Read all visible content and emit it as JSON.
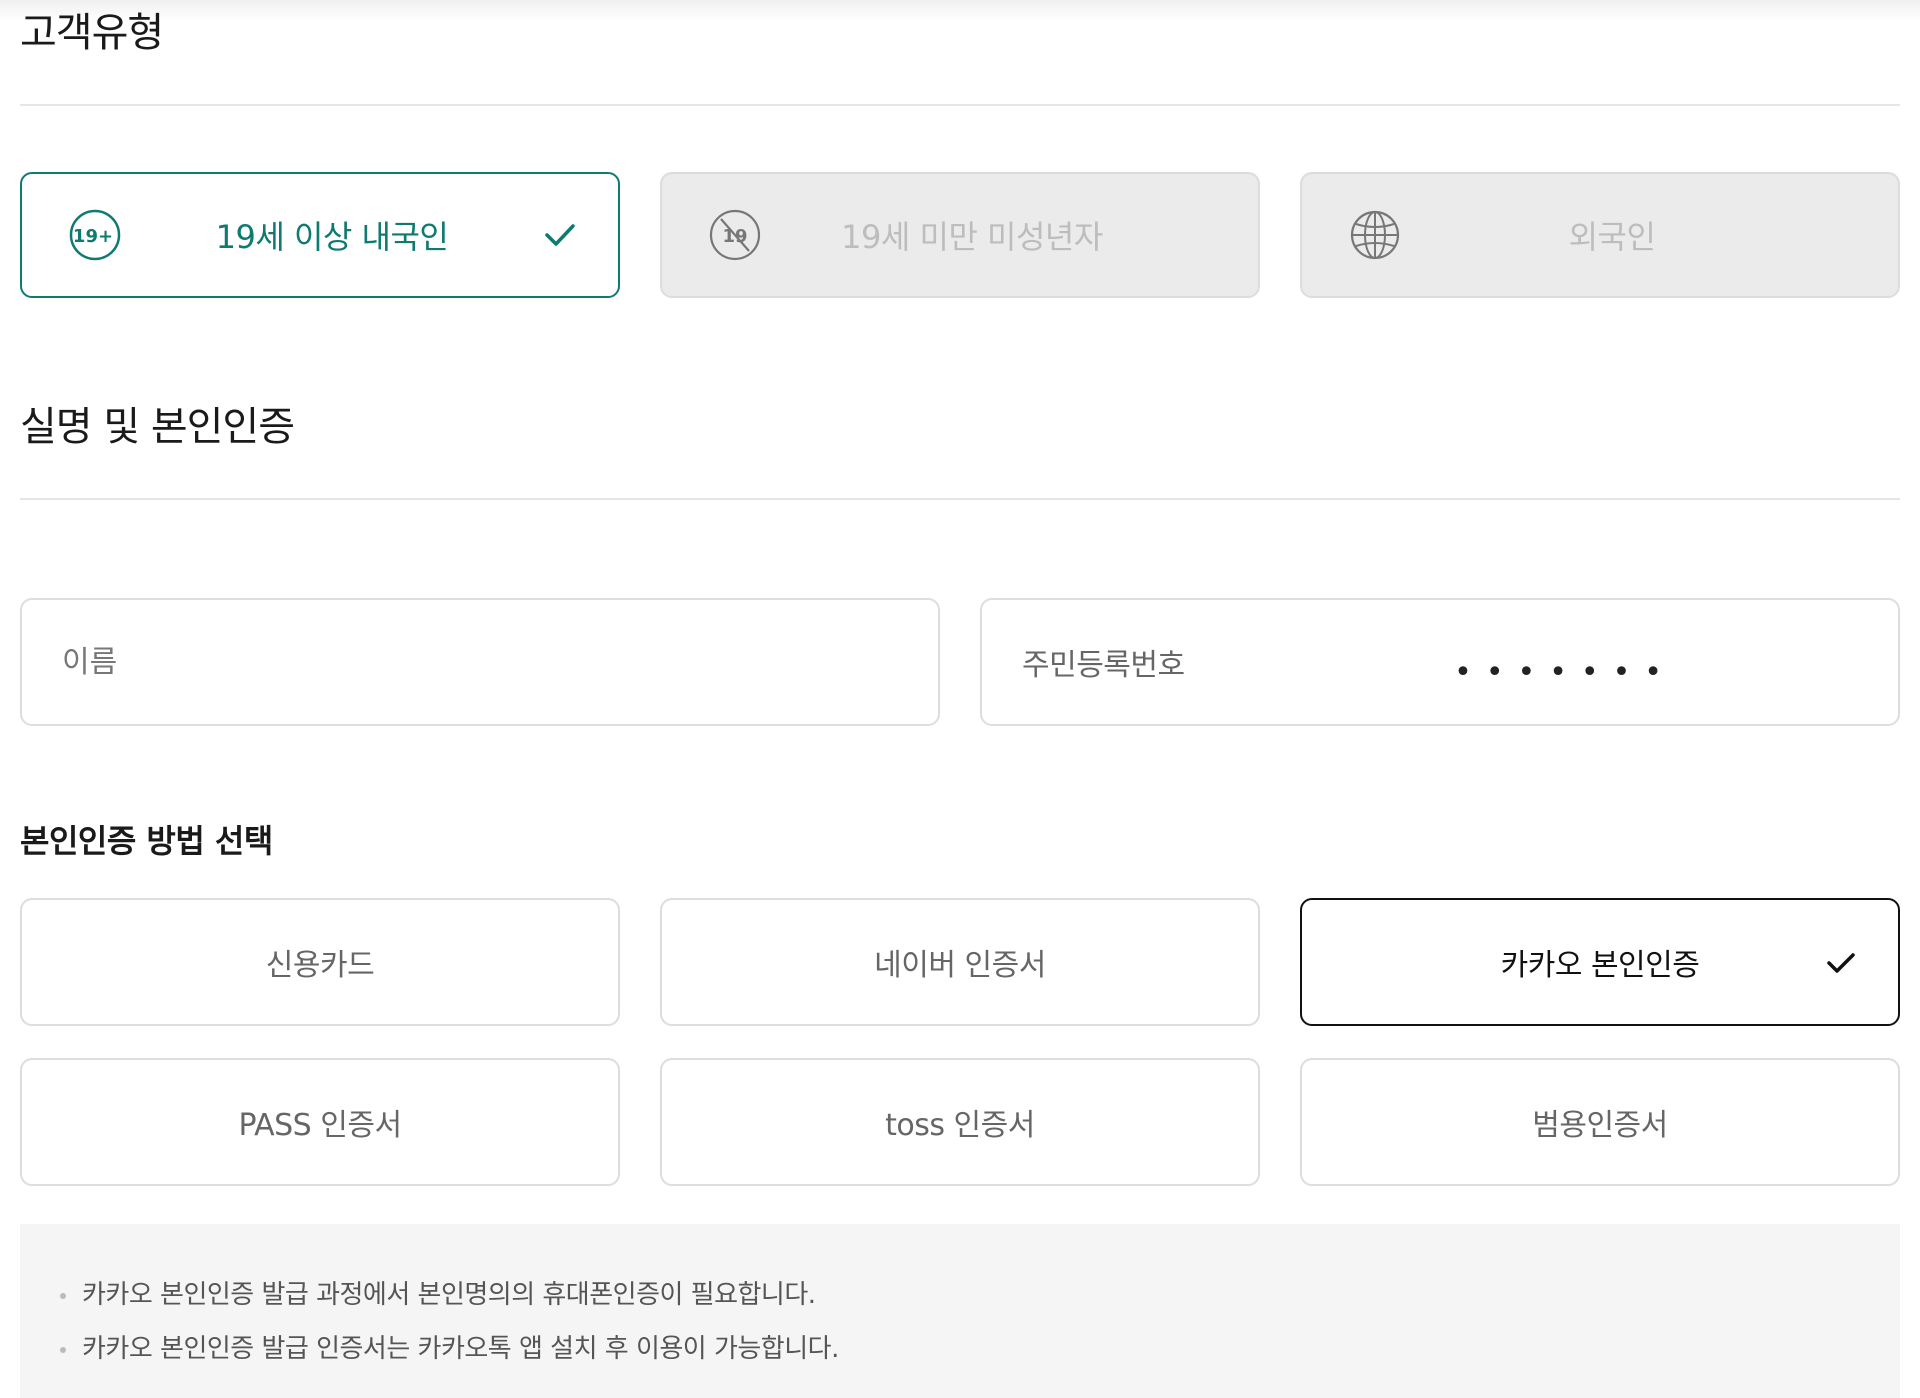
{
  "customer_type": {
    "title": "고객유형",
    "options": [
      {
        "label": "19세 이상 내국인",
        "badge": "19+",
        "icon": "adult-19-plus-icon",
        "state": "selected"
      },
      {
        "label": "19세 미만 미성년자",
        "badge": "19",
        "icon": "no-under-19-icon",
        "state": "disabled"
      },
      {
        "label": "외국인",
        "icon": "globe-icon",
        "state": "disabled"
      }
    ]
  },
  "verification": {
    "title": "실명 및 본인인증",
    "name_placeholder": "이름",
    "rrn_label": "주민등록번호",
    "rrn_masked": "•••••••"
  },
  "methods": {
    "title": "본인인증 방법 선택",
    "items": [
      {
        "label": "신용카드",
        "state": "default"
      },
      {
        "label": "네이버 인증서",
        "state": "default"
      },
      {
        "label": "카카오 본인인증",
        "state": "selected"
      },
      {
        "label": "PASS 인증서",
        "state": "default"
      },
      {
        "label": "toss 인증서",
        "state": "default"
      },
      {
        "label": "범용인증서",
        "state": "default"
      }
    ]
  },
  "notice": {
    "items": [
      "카카오 본인인증 발급 과정에서 본인명의의 휴대폰인증이 필요합니다.",
      "카카오 본인인증 발급 인증서는 카카오톡 앱 설치 후 이용이 가능합니다."
    ]
  },
  "colors": {
    "accent": "#0f7a70",
    "disabled_bg": "#ebebeb",
    "border": "#dddddd",
    "selected_border": "#111111"
  }
}
